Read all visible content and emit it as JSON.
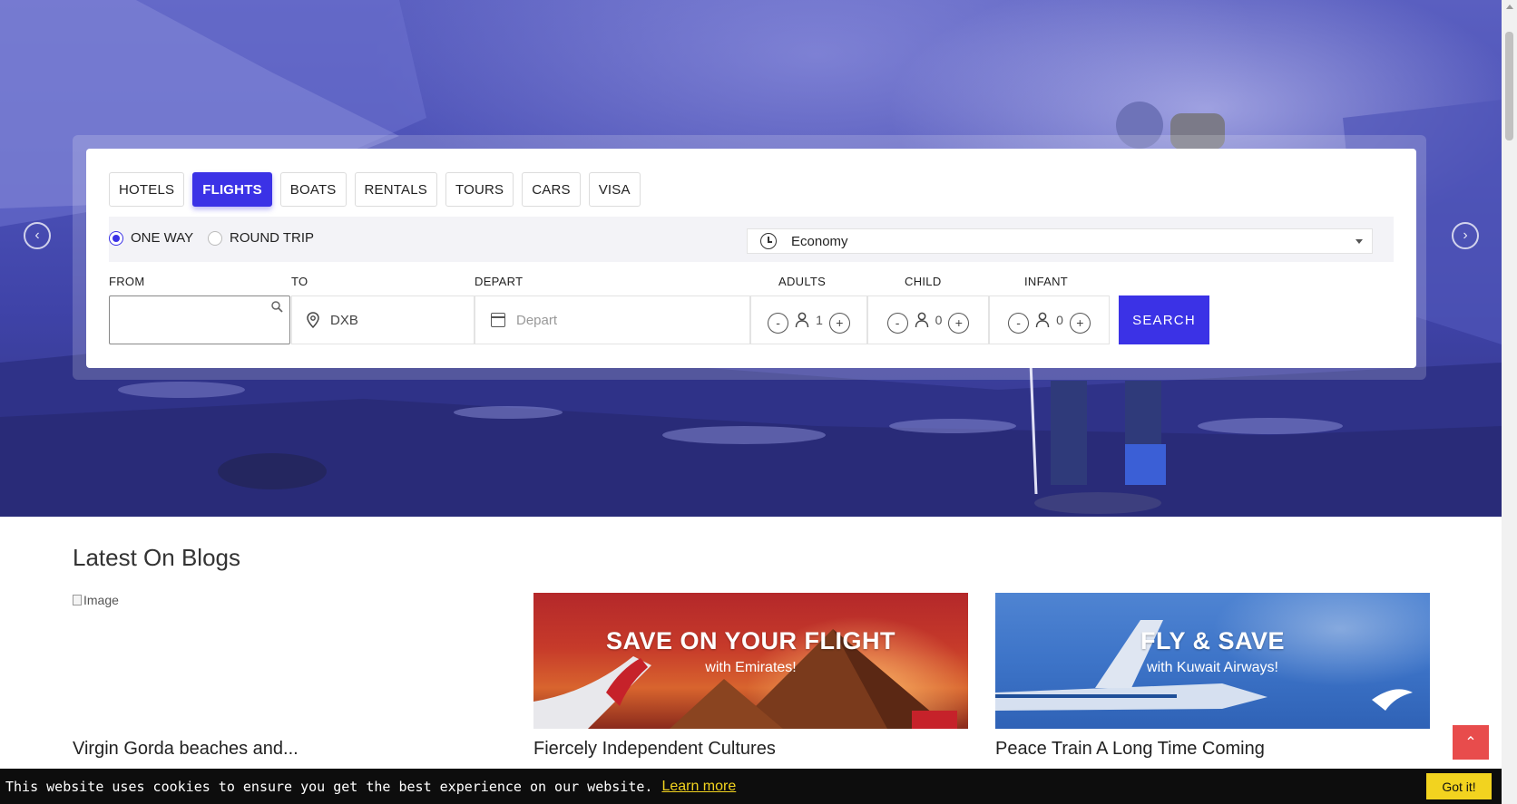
{
  "tabs": [
    {
      "label": "HOTELS",
      "active": false
    },
    {
      "label": "FLIGHTS",
      "active": true
    },
    {
      "label": "BOATS",
      "active": false
    },
    {
      "label": "RENTALS",
      "active": false
    },
    {
      "label": "TOURS",
      "active": false
    },
    {
      "label": "CARS",
      "active": false
    },
    {
      "label": "VISA",
      "active": false
    }
  ],
  "trip": {
    "one_way": "ONE WAY",
    "round_trip": "ROUND TRIP",
    "selected": "ONE WAY",
    "cabin_class": "Economy"
  },
  "fields": {
    "from_label": "FROM",
    "from_value": "",
    "to_label": "TO",
    "to_value": "DXB",
    "depart_label": "DEPART",
    "depart_placeholder": "Depart",
    "adults_label": "ADULTS",
    "adults_value": "1",
    "child_label": "CHILD",
    "child_value": "0",
    "infant_label": "INFANT",
    "infant_value": "0",
    "minus": "-",
    "plus": "+"
  },
  "search_button": "SEARCH",
  "blogs": {
    "heading": "Latest On Blogs",
    "broken_image_alt": "Image",
    "posts": [
      {
        "title": "Virgin Gorda beaches and..."
      },
      {
        "title": "Fiercely Independent Cultures",
        "promo_title": "SAVE ON YOUR FLIGHT",
        "promo_sub": "with Emirates!"
      },
      {
        "title": "Peace Train A Long Time Coming",
        "promo_title": "FLY & SAVE",
        "promo_sub": "with Kuwait Airways!"
      }
    ]
  },
  "cookie": {
    "message": "This website uses cookies to ensure you get the best experience on our website.",
    "learn_more": "Learn more",
    "accept": "Got it!"
  },
  "colors": {
    "accent": "#3b32e6",
    "to_top": "#e84c4c",
    "cookie_button": "#f2d31f"
  },
  "icons": {
    "prev": "chevron-left-icon",
    "next": "chevron-right-icon",
    "to_top": "chevron-up-icon"
  }
}
